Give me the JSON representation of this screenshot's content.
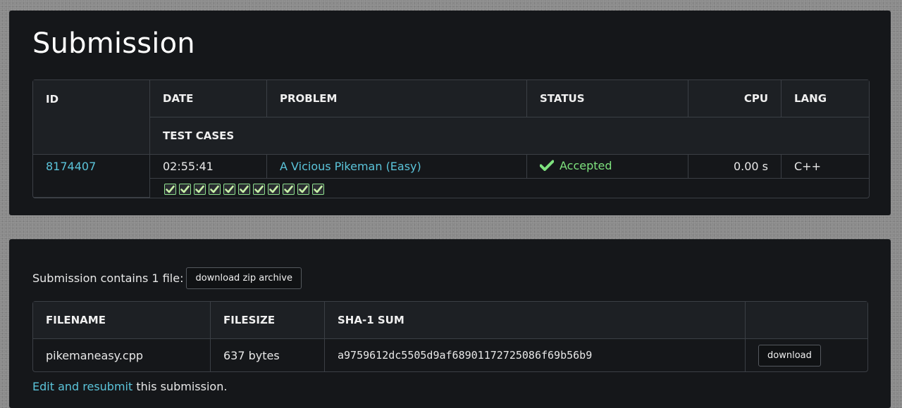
{
  "submission": {
    "title": "Submission",
    "headers": {
      "id": "ID",
      "date": "DATE",
      "problem": "PROBLEM",
      "status": "STATUS",
      "cpu": "CPU",
      "lang": "LANG",
      "test_cases": "TEST CASES"
    },
    "row": {
      "id": "8174407",
      "date": "02:55:41",
      "problem": "A Vicious Pikeman (Easy)",
      "status": "Accepted",
      "cpu": "0.00 s",
      "lang": "C++"
    },
    "test_cases": [
      "passed",
      "passed",
      "passed",
      "passed",
      "passed",
      "passed",
      "passed",
      "passed",
      "passed",
      "passed",
      "passed"
    ]
  },
  "files": {
    "intro": "Submission contains 1 file:",
    "zip_button": "download zip archive",
    "headers": {
      "filename": "FILENAME",
      "filesize": "FILESIZE",
      "sha1": "SHA-1 SUM"
    },
    "row": {
      "filename": "pikemaneasy.cpp",
      "filesize": "637 bytes",
      "sha1": "a9759612dc5505d9af68901172725086f69b56b9",
      "download_label": "download"
    },
    "resubmit_link": "Edit and resubmit",
    "resubmit_rest": " this submission."
  },
  "colors": {
    "accent_link": "#5bc4da",
    "accepted": "#7ee27e",
    "card_bg": "#15171a"
  }
}
